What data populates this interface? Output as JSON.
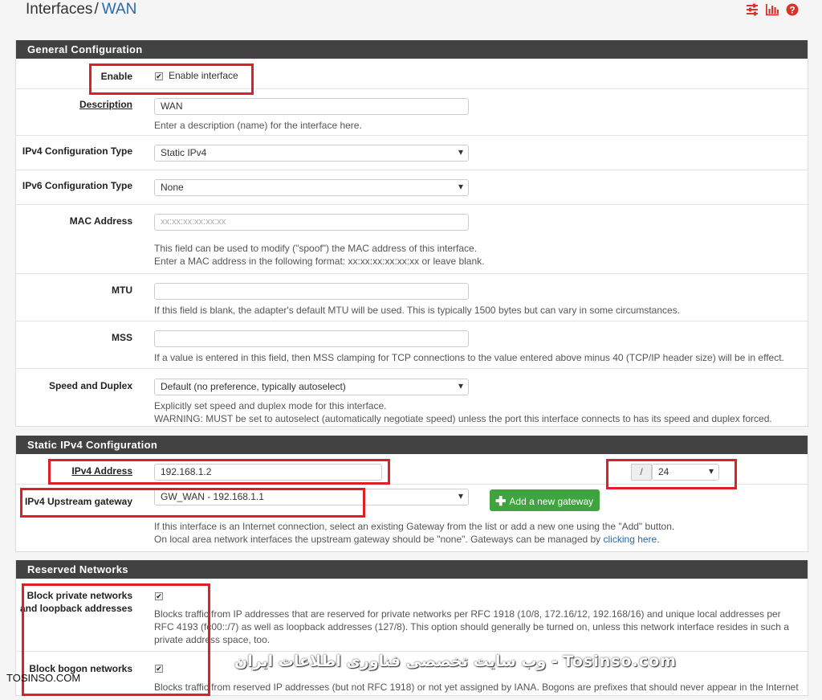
{
  "header": {
    "title": "Interfaces",
    "separator": "/",
    "current": "WAN",
    "icons": [
      "sliders-icon",
      "bar-chart-icon",
      "help-icon"
    ],
    "icon_color": "#d9342b"
  },
  "general": {
    "title": "General Configuration",
    "enable": {
      "label": "Enable",
      "checkbox_label": "Enable interface",
      "checked": true
    },
    "description": {
      "label": "Description",
      "value": "WAN",
      "help": "Enter a description (name) for the interface here."
    },
    "ipv4_type": {
      "label": "IPv4 Configuration Type",
      "value": "Static IPv4"
    },
    "ipv6_type": {
      "label": "IPv6 Configuration Type",
      "value": "None"
    },
    "mac": {
      "label": "MAC Address",
      "placeholder": "xx:xx:xx:xx:xx:xx",
      "help1": "This field can be used to modify (\"spoof\") the MAC address of this interface.",
      "help2": "Enter a MAC address in the following format: xx:xx:xx:xx:xx:xx or leave blank."
    },
    "mtu": {
      "label": "MTU",
      "value": "",
      "help": "If this field is blank, the adapter's default MTU will be used. This is typically 1500 bytes but can vary in some circumstances."
    },
    "mss": {
      "label": "MSS",
      "value": "",
      "help": "If a value is entered in this field, then MSS clamping for TCP connections to the value entered above minus 40 (TCP/IP header size) will be in effect."
    },
    "speed": {
      "label": "Speed and Duplex",
      "value": "Default (no preference, typically autoselect)",
      "help1": "Explicitly set speed and duplex mode for this interface.",
      "help2": "WARNING: MUST be set to autoselect (automatically negotiate speed) unless the port this interface connects to has its speed and duplex forced."
    }
  },
  "static": {
    "title": "Static IPv4 Configuration",
    "ipv4": {
      "label": "IPv4 Address",
      "value": "192.168.1.2",
      "slash": "/",
      "cidr": "24"
    },
    "gateway": {
      "label": "IPv4 Upstream gateway",
      "value": "GW_WAN - 192.168.1.1",
      "add_button": "Add a new gateway",
      "help1": "If this interface is an Internet connection, select an existing Gateway from the list or add a new one using the \"Add\" button.",
      "help2_prefix": "On local area network interfaces the upstream gateway should be \"none\". Gateways can be managed by ",
      "help2_link": "clicking here",
      "help2_suffix": "."
    }
  },
  "reserved": {
    "title": "Reserved Networks",
    "private": {
      "label_line1": "Block private networks",
      "label_line2": "and loopback addresses",
      "checked": true,
      "help1": "Blocks traffic from IP addresses that are reserved for private networks per RFC 1918 (10/8, 172.16/12, 192.168/16) and unique local addresses per",
      "help2": "RFC 4193 (fc00::/7) as well as loopback addresses (127/8). This option should generally be turned on, unless this network interface resides in such a",
      "help3": "private address space, too."
    },
    "bogon": {
      "label": "Block bogon networks",
      "checked": true,
      "help1": "Blocks traffic from reserved IP addresses (but not RFC 1918) or not yet assigned by IANA. Bogons are prefixes that should never appear in the Internet"
    }
  },
  "watermark": {
    "center": "وب سایت تخصصی فناوری اطلاعات ایران - Tosinso.com",
    "left": "TOSINSO.COM"
  },
  "highlight_color": "#e01e26"
}
